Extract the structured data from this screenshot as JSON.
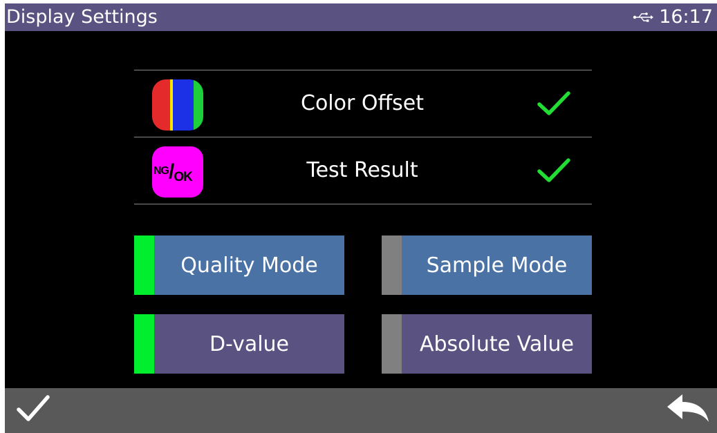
{
  "titlebar": {
    "title": "Display Settings",
    "time": "16:17",
    "status_icon": "usb-icon"
  },
  "display_options": [
    {
      "label": "Color Offset",
      "icon": "color-offset-icon",
      "checked": true
    },
    {
      "label": "Test Result",
      "icon": "ng-ok-icon",
      "icon_text_ng": "NG",
      "icon_text_slash": "/",
      "icon_text_ok": "OK",
      "checked": true
    }
  ],
  "mode_buttons": [
    {
      "label": "Quality Mode",
      "selected": true
    },
    {
      "label": "Sample Mode",
      "selected": false
    }
  ],
  "value_buttons": [
    {
      "label": "D-value",
      "selected": true
    },
    {
      "label": "Absolute Value",
      "selected": false
    }
  ],
  "footer": {
    "confirm_icon": "checkmark-icon",
    "back_icon": "back-arrow-icon"
  },
  "colors": {
    "titlebar_bg": "#5a5280",
    "mode_button_bg": "#4a72a5",
    "value_button_bg": "#5a5280",
    "indicator_on": "#00ee2e",
    "indicator_off": "#808080",
    "check_green": "#22dd33",
    "footer_bg": "#595959"
  }
}
